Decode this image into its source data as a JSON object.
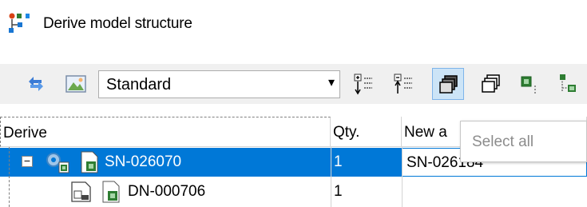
{
  "window": {
    "title": "Derive model structure",
    "title_icon": "derive-structure-icon"
  },
  "toolbar": {
    "buttons": [
      {
        "name": "refresh-icon"
      },
      {
        "name": "picture-icon"
      },
      {
        "name": "expand-tree-icon"
      },
      {
        "name": "collapse-tree-icon"
      },
      {
        "name": "stacked-windows-filled-icon",
        "pressed": true
      },
      {
        "name": "stacked-windows-outline-icon"
      },
      {
        "name": "green-node-icon"
      },
      {
        "name": "node-hierarchy-icon"
      }
    ],
    "view_select": {
      "value": "Standard",
      "arrow": "▾"
    }
  },
  "grid": {
    "columns": [
      "Derive",
      "Qty.",
      "New a"
    ],
    "rows": [
      {
        "id": "SN-026070",
        "qty": "1",
        "new_article": "SN-026184",
        "selected": true,
        "expander": "−"
      },
      {
        "id": "DN-000706",
        "qty": "1",
        "new_article": ""
      }
    ]
  },
  "tooltip": {
    "text": "Select all"
  },
  "colors": {
    "selection": "#0078d7",
    "toolbar_bg": "#f0f0f0",
    "pressed_bg": "#cce4f7"
  }
}
